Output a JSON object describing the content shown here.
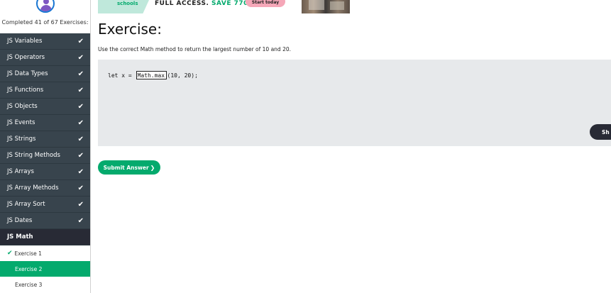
{
  "sidebar": {
    "progress_text": "Completed 41 of 67 Exercises:",
    "topics": [
      {
        "label": "JS Variables",
        "done": true
      },
      {
        "label": "JS Operators",
        "done": true
      },
      {
        "label": "JS Data Types",
        "done": true
      },
      {
        "label": "JS Functions",
        "done": true
      },
      {
        "label": "JS Objects",
        "done": true
      },
      {
        "label": "JS Events",
        "done": true
      },
      {
        "label": "JS Strings",
        "done": true
      },
      {
        "label": "JS String Methods",
        "done": true
      },
      {
        "label": "JS Arrays",
        "done": true
      },
      {
        "label": "JS Array Methods",
        "done": true
      },
      {
        "label": "JS Array Sort",
        "done": true
      },
      {
        "label": "JS Dates",
        "done": true
      },
      {
        "label": "JS Math",
        "done": false
      }
    ],
    "exercises": [
      {
        "label": "Exercise 1",
        "state": "done"
      },
      {
        "label": "Exercise 2",
        "state": "current"
      },
      {
        "label": "Exercise 3",
        "state": "todo"
      }
    ],
    "check_glyph": "✔"
  },
  "ad": {
    "brand_text": "schools",
    "headline": "FULL ACCESS.",
    "price": "SAVE 770$",
    "cta": "Start today"
  },
  "main": {
    "title": "Exercise:",
    "instruction": "Use the correct Math method to return the largest number of 10 and 20.",
    "code_prefix": "let x = ",
    "answer_value": "Math.max",
    "code_suffix": "(10, 20);",
    "show_answer_label": "Sh",
    "submit_label": "Submit Answer",
    "submit_chevron": "❯"
  },
  "colors": {
    "accent": "#04aa6d",
    "sidebar_bg": "#38444d",
    "code_bg": "#e7e9eb",
    "dark_button": "#282a35"
  }
}
